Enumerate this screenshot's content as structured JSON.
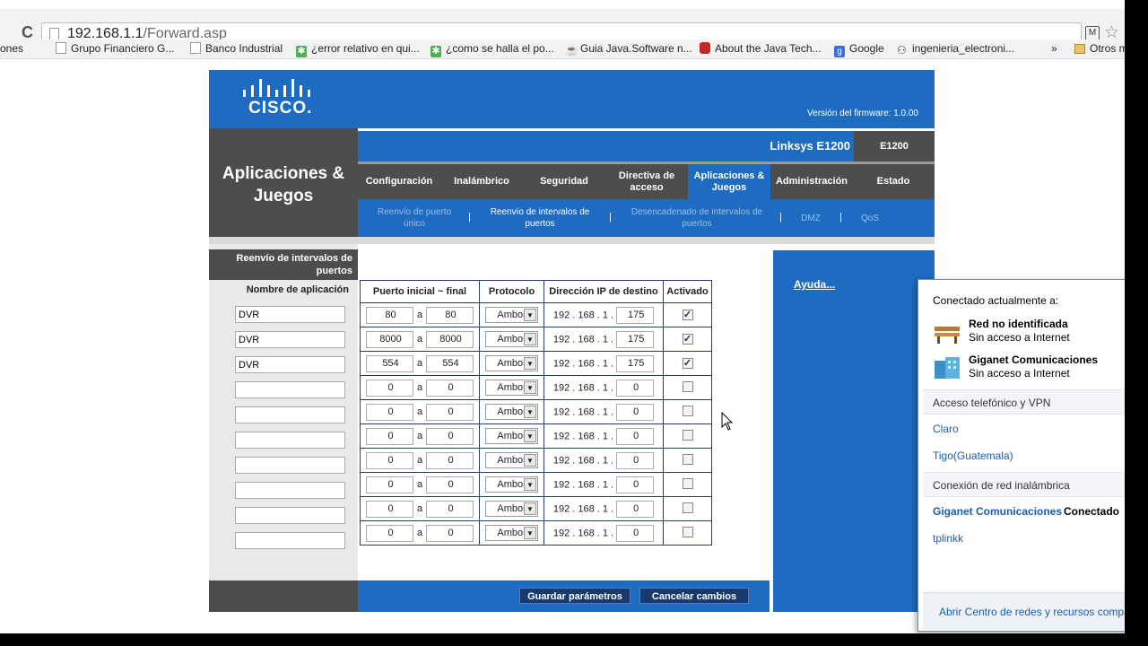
{
  "browser": {
    "url_host": "192.168.1.1",
    "url_path": "/Forward.asp",
    "bookmarks": [
      {
        "label": "ones",
        "icon": "none"
      },
      {
        "label": "Grupo Financiero G...",
        "icon": "page-icon"
      },
      {
        "label": "Banco Industrial",
        "icon": "page-icon"
      },
      {
        "label": "¿error relativo en qui...",
        "icon": "answers-icon"
      },
      {
        "label": "¿como se halla el po...",
        "icon": "answers-icon"
      },
      {
        "label": "Guia Java.Software n...",
        "icon": "java-icon"
      },
      {
        "label": "About the Java Tech...",
        "icon": "oracle-icon"
      },
      {
        "label": "Google",
        "icon": "google-icon"
      },
      {
        "label": "ingenieria_electroni...",
        "icon": "group-icon"
      },
      {
        "label": "»",
        "icon": "none"
      },
      {
        "label": "Otros m",
        "icon": "folder-icon"
      }
    ]
  },
  "router": {
    "brand": "CISCO.",
    "firmware": "Versión del firmware: 1.0.00",
    "section_title": "Aplicaciones & Juegos",
    "model_name": "Linksys E1200",
    "model_code": "E1200",
    "tabs": [
      {
        "label": "Configuración",
        "active": false
      },
      {
        "label": "Inalámbrico",
        "active": false
      },
      {
        "label": "Seguridad",
        "active": false
      },
      {
        "label": "Directiva de acceso",
        "active": false
      },
      {
        "label": "Aplicaciones & Juegos",
        "active": true
      },
      {
        "label": "Administración",
        "active": false
      },
      {
        "label": "Estado",
        "active": false
      }
    ],
    "subtabs": [
      {
        "label": "Reenvío de puerto único",
        "active": false
      },
      {
        "label": "Reenvío de intervalos de puertos",
        "active": true
      },
      {
        "label": "Desencadenado de intervalos de puertos",
        "active": false
      },
      {
        "label": "DMZ",
        "active": false
      },
      {
        "label": "QoS",
        "active": false
      }
    ],
    "left_section": "Reenvío de intervalos de puertos",
    "app_name_header": "Nombre de aplicación",
    "table_headers": [
      "Puerto inicial ~ final",
      "Protocolo",
      "Dirección IP de destino",
      "Activado"
    ],
    "range_sep": "a",
    "ip_prefix": "192 . 168 . 1 .",
    "rows": [
      {
        "app": "DVR",
        "start": "80",
        "end": "80",
        "protocol": "Ambos",
        "ip_last": "175",
        "enabled": true
      },
      {
        "app": "DVR",
        "start": "8000",
        "end": "8000",
        "protocol": "Ambos",
        "ip_last": "175",
        "enabled": true
      },
      {
        "app": "DVR",
        "start": "554",
        "end": "554",
        "protocol": "Ambos",
        "ip_last": "175",
        "enabled": true
      },
      {
        "app": "",
        "start": "0",
        "end": "0",
        "protocol": "Ambos",
        "ip_last": "0",
        "enabled": false
      },
      {
        "app": "",
        "start": "0",
        "end": "0",
        "protocol": "Ambos",
        "ip_last": "0",
        "enabled": false
      },
      {
        "app": "",
        "start": "0",
        "end": "0",
        "protocol": "Ambos",
        "ip_last": "0",
        "enabled": false
      },
      {
        "app": "",
        "start": "0",
        "end": "0",
        "protocol": "Ambos",
        "ip_last": "0",
        "enabled": false
      },
      {
        "app": "",
        "start": "0",
        "end": "0",
        "protocol": "Ambos",
        "ip_last": "0",
        "enabled": false
      },
      {
        "app": "",
        "start": "0",
        "end": "0",
        "protocol": "Ambos",
        "ip_last": "0",
        "enabled": false
      },
      {
        "app": "",
        "start": "0",
        "end": "0",
        "protocol": "Ambos",
        "ip_last": "0",
        "enabled": false
      }
    ],
    "help_link": "Ayuda...",
    "save_button": "Guardar parámetros",
    "cancel_button": "Cancelar cambios"
  },
  "network_flyout": {
    "header": "Conectado actualmente a:",
    "networks": [
      {
        "name": "Red no identificada",
        "status": "Sin acceso a Internet",
        "icon": "bench-icon"
      },
      {
        "name": "Giganet Comunicaciones",
        "status": "Sin acceso a Internet",
        "icon": "building-icon"
      }
    ],
    "dialup_section": "Acceso telefónico y VPN",
    "dialup_items": [
      "Claro",
      "Tigo(Guatemala)"
    ],
    "wireless_section": "Conexión de red inalámbrica",
    "wireless_items": [
      {
        "name": "Giganet Comunicaciones",
        "status": "Conectado"
      },
      {
        "name": "tplinkk",
        "status": ""
      }
    ],
    "footer_link": "Abrir Centro de redes y recursos compa"
  }
}
